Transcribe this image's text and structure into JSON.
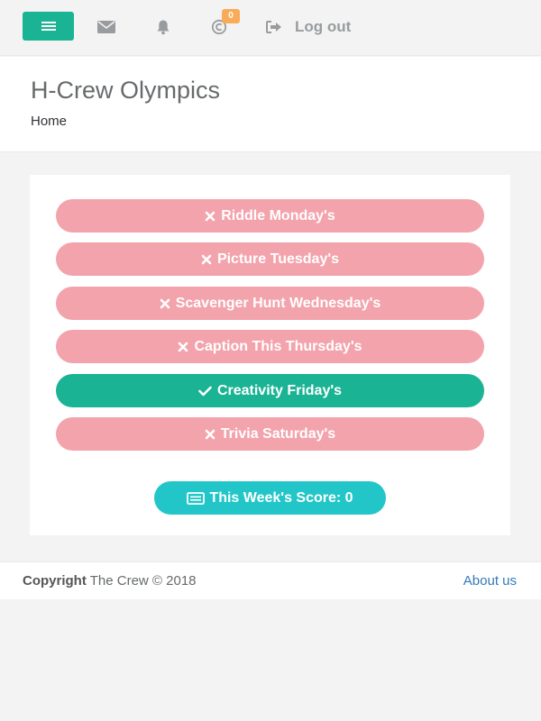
{
  "navbar": {
    "badge_count": "0",
    "logout_label": "Log out"
  },
  "heading": {
    "title": "H-Crew Olympics",
    "breadcrumb": "Home"
  },
  "days": [
    {
      "label": "Riddle Monday's",
      "status": "failed"
    },
    {
      "label": "Picture Tuesday's",
      "status": "failed"
    },
    {
      "label": "Scavenger Hunt Wednesday's",
      "status": "failed"
    },
    {
      "label": "Caption This Thursday's",
      "status": "failed"
    },
    {
      "label": "Creativity Friday's",
      "status": "completed"
    },
    {
      "label": "Trivia Saturday's",
      "status": "failed"
    }
  ],
  "score": {
    "label": "This Week's Score: 0"
  },
  "footer": {
    "copyright_strong": "Copyright",
    "copyright_rest": "The Crew © 2018",
    "about": "About us"
  },
  "colors": {
    "primary": "#1ab394",
    "failed": "#f3a3ac",
    "info": "#23c6c8",
    "badge": "#f8ac59",
    "link": "#337ab7"
  },
  "icons": {
    "menu": "bars-icon",
    "mail": "envelope-icon",
    "bell": "bell-icon",
    "copyright": "copyright-icon",
    "logout": "sign-out-icon",
    "failed": "times-icon",
    "completed": "check-icon",
    "score": "id-card-icon"
  }
}
